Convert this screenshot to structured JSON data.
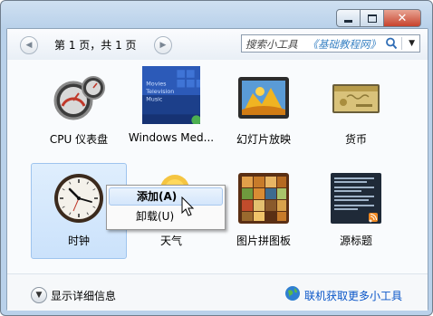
{
  "pager": {
    "text": "第 1 页，共 1 页"
  },
  "search": {
    "placeholder": "搜索小工具",
    "brand": "《基础教程网》"
  },
  "gadgets": [
    {
      "label": "CPU 仪表盘",
      "icon": "cpu-gauge-icon"
    },
    {
      "label": "Windows Med...",
      "icon": "media-center-icon",
      "lines": [
        "Movies",
        "Television",
        "Music"
      ]
    },
    {
      "label": "幻灯片放映",
      "icon": "slideshow-icon"
    },
    {
      "label": "货币",
      "icon": "currency-icon"
    },
    {
      "label": "时钟",
      "icon": "clock-icon",
      "selected": true
    },
    {
      "label": "天气",
      "icon": "weather-icon"
    },
    {
      "label": "图片拼图板",
      "icon": "puzzle-icon"
    },
    {
      "label": "源标题",
      "icon": "feed-headlines-icon"
    }
  ],
  "context_menu": {
    "items": [
      "添加(A)",
      "卸载(U)"
    ]
  },
  "footer": {
    "details": "显示详细信息",
    "more": "联机获取更多小工具"
  }
}
